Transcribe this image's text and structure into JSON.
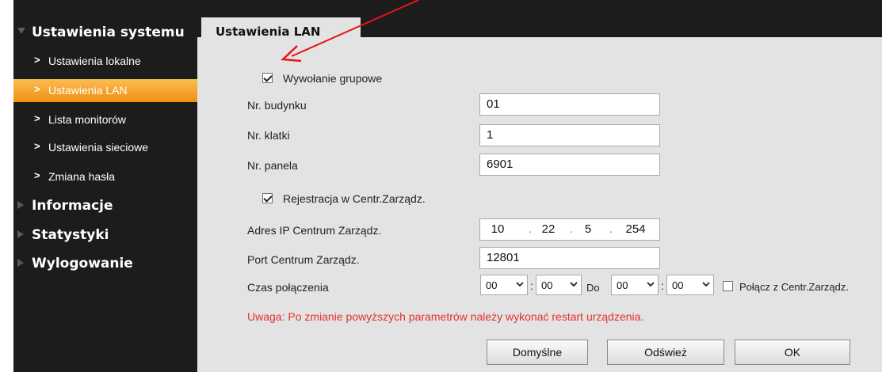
{
  "sidebar": {
    "section_system": "Ustawienia systemu",
    "items": [
      {
        "label": "Ustawienia lokalne"
      },
      {
        "label": "Ustawienia LAN"
      },
      {
        "label": "Lista monitorów"
      },
      {
        "label": "Ustawienia sieciowe"
      },
      {
        "label": "Zmiana hasła"
      }
    ],
    "section_info": "Informacje",
    "section_stats": "Statystyki",
    "section_logout": "Wylogowanie"
  },
  "tab": {
    "title": "Ustawienia LAN"
  },
  "form": {
    "group_call": {
      "label": "Wywołanie grupowe",
      "checked": true
    },
    "building_no": {
      "label": "Nr. budynku",
      "value": "01"
    },
    "stairwell_no": {
      "label": "Nr. klatki",
      "value": "1"
    },
    "panel_no": {
      "label": "Nr. panela",
      "value": "6901"
    },
    "registration": {
      "label": "Rejestracja w Centr.Zarządz.",
      "checked": true
    },
    "ip": {
      "label": "Adres IP Centrum Zarządz.",
      "octets": [
        "10",
        "22",
        "5",
        "254"
      ]
    },
    "port": {
      "label": "Port Centrum Zarządz.",
      "value": "12801"
    },
    "time": {
      "label": "Czas połączenia",
      "from_h": "00",
      "from_m": "00",
      "to_label": "Do",
      "to_h": "00",
      "to_m": "00",
      "connect_label": "Połącz z Centr.Zarządz.",
      "connect_checked": false
    },
    "warning": "Uwaga: Po zmianie powyższych parametrów należy wykonać restart urządzenia."
  },
  "buttons": {
    "default": "Domyślne",
    "refresh": "Odśwież",
    "ok": "OK"
  },
  "colors": {
    "accent": "#f39c1e",
    "annotation_arrow": "#e8141b",
    "warning": "#e4302b"
  }
}
